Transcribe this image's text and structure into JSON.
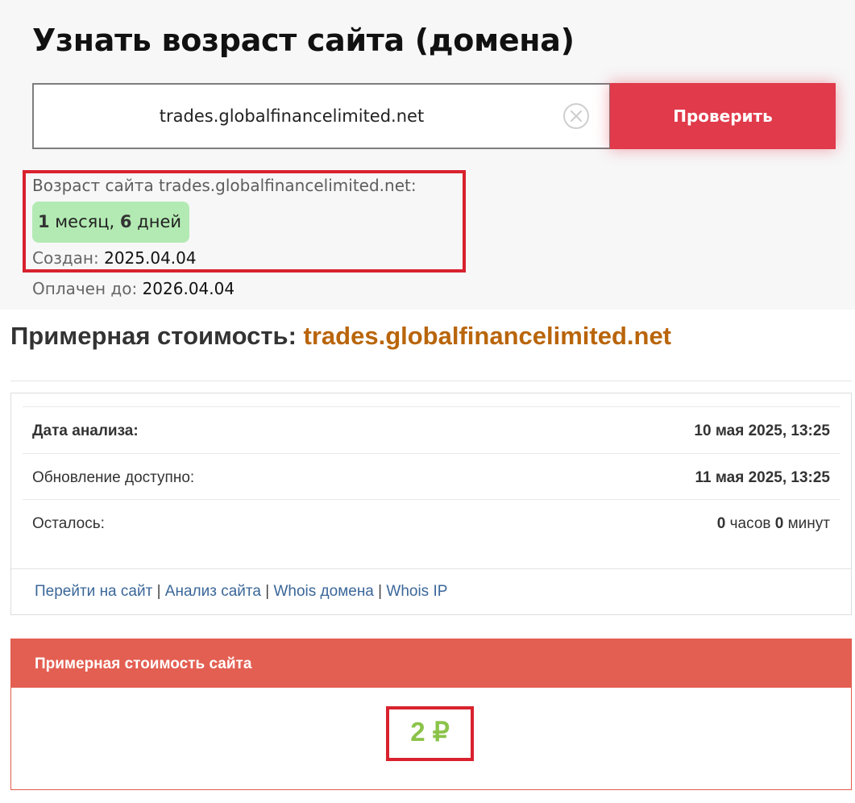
{
  "top": {
    "title": "Узнать возраст сайта (домена)",
    "search": {
      "value": "trades.globalfinancelimited.net",
      "button_label": "Проверить",
      "clear_icon": "close-circle-icon"
    },
    "age": {
      "label": "Возраст сайта trades.globalfinancelimited.net:",
      "months_num": "1",
      "months_word": " месяц, ",
      "days_num": "6",
      "days_word": " дней"
    },
    "created_label": "Создан: ",
    "created_value": "2025.04.04",
    "paid_label": "Оплачен до: ",
    "paid_value": "2026.04.04"
  },
  "estimate": {
    "title_prefix": "Примерная стоимость: ",
    "domain": "trades.globalfinancelimited.net",
    "rows": [
      {
        "label": "Дата анализа:",
        "value": "10 мая 2025, 13:25"
      },
      {
        "label": "Обновление доступно:",
        "value": "11 мая 2025, 13:25"
      },
      {
        "label": "Осталось:",
        "hours": "0",
        "hours_word": " часов ",
        "minutes": "0",
        "minutes_word": " минут"
      }
    ],
    "links": [
      "Перейти на сайт",
      "Анализ сайта",
      "Whois домена",
      "Whois IP"
    ],
    "separator": " | ",
    "price_header": "Примерная стоимость сайта",
    "price_value": "2 ₽"
  },
  "colors": {
    "accent_red": "#e03a4b",
    "badge_green": "#b3eab3",
    "domain_orange": "#b9650a",
    "price_green": "#8bc34a",
    "header_red": "#e35f52",
    "link_blue": "#3b6799"
  }
}
